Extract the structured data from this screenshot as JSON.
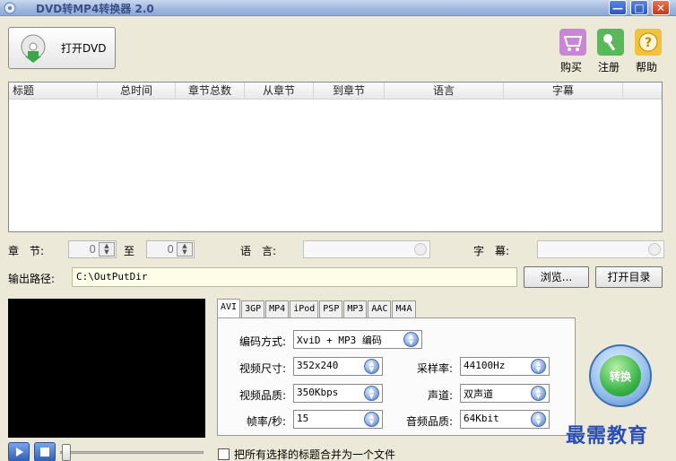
{
  "window": {
    "title": "DVD转MP4转换器 2.0",
    "min_glyph": "—",
    "max_glyph": "□",
    "close_glyph": "✕"
  },
  "toolbar": {
    "open_dvd_label": "打开DVD",
    "buy_label": "购买",
    "register_label": "注册",
    "help_label": "帮助",
    "icons": {
      "open_dvd": "dvd-disc-icon",
      "buy": "cart-icon",
      "register": "key-icon",
      "help": "help-icon"
    }
  },
  "title_list": {
    "columns": [
      "标题",
      "总时间",
      "章节总数",
      "从章节",
      "到章节",
      "语言",
      "字幕"
    ],
    "rows": []
  },
  "chapter": {
    "label": "章　节:",
    "from_value": "0",
    "to_label": "至",
    "to_value": "0",
    "language_label": "语　言:",
    "subtitle_label": "字　幕:"
  },
  "output": {
    "label": "输出路径:",
    "path": "C:\\OutPutDir",
    "browse_label": "浏览...",
    "open_dir_label": "打开目录"
  },
  "format_tabs": [
    {
      "label": "AVI",
      "active": true
    },
    {
      "label": "3GP",
      "active": false
    },
    {
      "label": "MP4",
      "active": false
    },
    {
      "label": "iPod",
      "active": false
    },
    {
      "label": "PSP",
      "active": false
    },
    {
      "label": "MP3",
      "active": false
    },
    {
      "label": "AAC",
      "active": false
    },
    {
      "label": "M4A",
      "active": false
    }
  ],
  "settings": {
    "encoding": {
      "label": "编码方式:",
      "value": "XviD + MP3 编码"
    },
    "video_size": {
      "label": "视频尺寸:",
      "value": "352x240"
    },
    "video_quality": {
      "label": "视频品质:",
      "value": "350Kbps"
    },
    "frame_rate": {
      "label": "帧率/秒:",
      "value": "15"
    },
    "sample_rate": {
      "label": "采样率:",
      "value": "44100Hz"
    },
    "channels": {
      "label": "声道:",
      "value": "双声道"
    },
    "audio_quality": {
      "label": "音频品质:",
      "value": "64Kbit"
    }
  },
  "convert_label": "转换",
  "merge": {
    "label": "把所有选择的标题合并为一个文件",
    "checked": false
  },
  "player": {
    "play_icon": "play-icon",
    "stop_icon": "stop-icon",
    "position": 0
  },
  "watermark": "最需教育",
  "colors": {
    "accent": "#3c6fb5",
    "convert_green": "#3cb64a",
    "path_bg": "#fefee8"
  }
}
